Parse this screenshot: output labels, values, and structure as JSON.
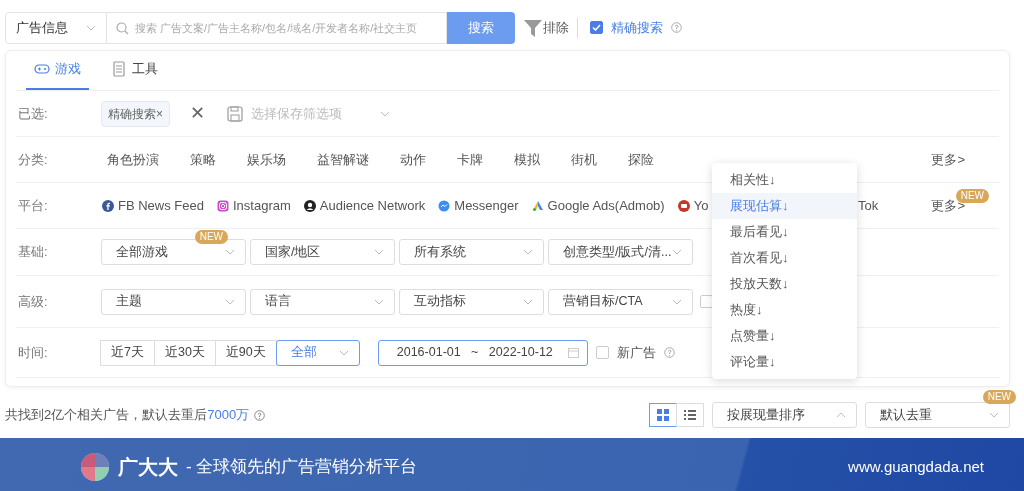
{
  "search": {
    "scope": "广告信息",
    "placeholder": "搜索 广告文案/广告主名称/包名/域名/开发者名称/社交主页",
    "button": "搜索",
    "exclude": "排除",
    "exact": {
      "label": "精确搜索",
      "checked": true
    }
  },
  "tabs": [
    {
      "label": "游戏",
      "selected": true
    },
    {
      "label": "工具",
      "selected": false
    }
  ],
  "rows": [
    {
      "kind": "chosen",
      "label": "已选:",
      "chips": [
        "精确搜索×"
      ],
      "clear": "✕",
      "saved_placeholder": "选择保存筛选项"
    },
    {
      "kind": "links",
      "label": "分类:",
      "items": [
        "角色扮演",
        "策略",
        "娱乐场",
        "益智解谜",
        "动作",
        "卡牌",
        "模拟",
        "街机",
        "探险"
      ],
      "more": "更多>"
    },
    {
      "kind": "platforms",
      "label": "平台:",
      "items": [
        "FB News Feed",
        "Instagram",
        "Audience Network",
        "Messenger",
        "Google Ads(Admob)",
        "Yo",
        "Tok"
      ],
      "more": "更多>",
      "more_badge": "NEW"
    },
    {
      "kind": "selects",
      "label": "基础:",
      "selects": [
        {
          "value": "全部游戏",
          "badge": "NEW"
        },
        {
          "value": "国家/地区"
        },
        {
          "value": "所有系统"
        },
        {
          "value": "创意类型/版式/清..."
        }
      ]
    },
    {
      "kind": "selects",
      "label": "高级:",
      "selects": [
        {
          "value": "主题"
        },
        {
          "value": "语言"
        },
        {
          "value": "互动指标"
        },
        {
          "value": "营销目标/CTA"
        }
      ],
      "checkbox": {
        "checked": false
      }
    },
    {
      "kind": "time",
      "label": "时间:",
      "buttons": [
        {
          "label": "近7天",
          "selected": false
        },
        {
          "label": "近30天",
          "selected": false
        },
        {
          "label": "近90天",
          "selected": false
        }
      ],
      "select": {
        "value": "全部",
        "selected": true
      },
      "start": "2016-01-01",
      "separator": "~",
      "end": "2022-10-12",
      "new_ads": {
        "label": "新广告",
        "checked": false
      }
    }
  ],
  "sort_menu": [
    {
      "label": "相关性↓",
      "selected": false
    },
    {
      "label": "展现估算↓",
      "selected": true
    },
    {
      "label": "最后看见↓",
      "selected": false
    },
    {
      "label": "首次看见↓",
      "selected": false
    },
    {
      "label": "投放天数↓",
      "selected": false
    },
    {
      "label": "热度↓",
      "selected": false
    },
    {
      "label": "点赞量↓",
      "selected": false
    },
    {
      "label": "评论量↓",
      "selected": false
    }
  ],
  "results": {
    "summary": "共找到2亿个相关广告，默认去重后",
    "count": "7000万",
    "views": [
      {
        "kind": "grid",
        "selected": true
      },
      {
        "kind": "list",
        "selected": false
      }
    ],
    "sort": {
      "value": "按展现量排序",
      "expanded": true
    },
    "dedupe": {
      "value": "默认去重",
      "badge": "NEW"
    }
  },
  "footer": {
    "brand": "广大大",
    "slogan": "- 全球领先的广告营销分析平台",
    "url": "www.guangdada.net"
  }
}
